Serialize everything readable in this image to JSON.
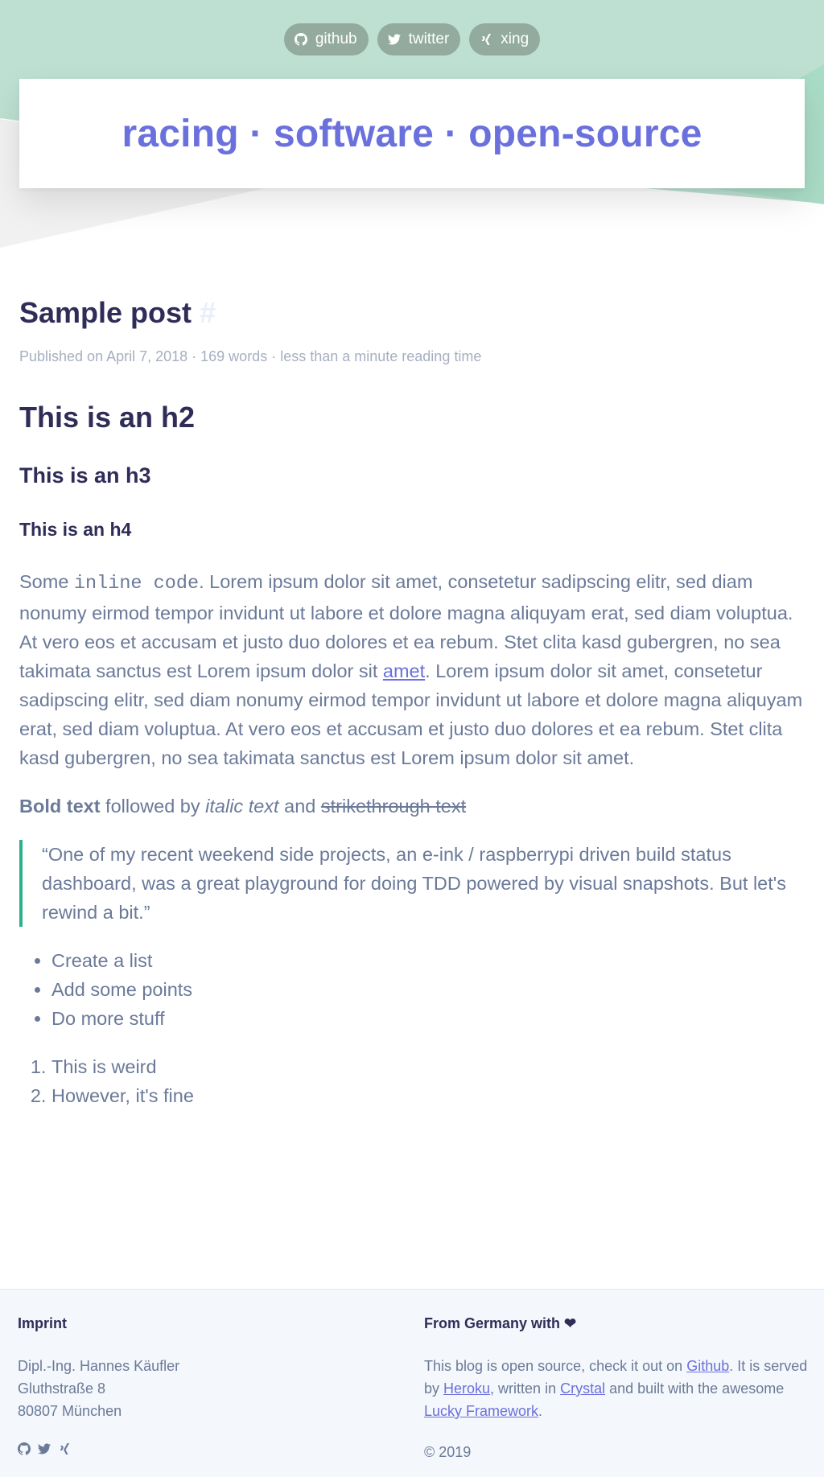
{
  "colors": {
    "accent": "#6a70dc",
    "mint": "#bde0d2",
    "heading": "#2f2d58",
    "text": "#6b7a99",
    "quote_bar": "#2eb08e",
    "pill": "#93ab9f"
  },
  "social": [
    {
      "label": "github",
      "icon": "github-icon"
    },
    {
      "label": "twitter",
      "icon": "twitter-icon"
    },
    {
      "label": "xing",
      "icon": "xing-icon"
    }
  ],
  "site_title": "racing · software · open-source",
  "post": {
    "title": "Sample post",
    "anchor": "#",
    "meta": "Published on April 7, 2018 · 169 words · less than a minute reading time",
    "h2": "This is an h2",
    "h3": "This is an h3",
    "h4": "This is an h4",
    "para_start": "Some ",
    "inline_code": "inline code",
    "para_mid": ". Lorem ipsum dolor sit amet, consetetur sadipscing elitr, sed diam nonumy eirmod tempor invidunt ut labore et dolore magna aliquyam erat, sed diam voluptua. At vero eos et accusam et justo duo dolores et ea rebum. Stet clita kasd gubergren, no sea takimata sanctus est Lorem ipsum dolor sit ",
    "para_link": "amet",
    "para_end": ". Lorem ipsum dolor sit amet, consetetur sadipscing elitr, sed diam nonumy eirmod tempor invidunt ut labore et dolore magna aliquyam erat, sed diam voluptua. At vero eos et accusam et justo duo dolores et ea rebum. Stet clita kasd gubergren, no sea takimata sanctus est Lorem ipsum dolor sit amet.",
    "bold": "Bold text",
    "followed_by": " followed by ",
    "italic": "italic text",
    "and": " and ",
    "strike": "strikethrough text",
    "quote": "“One of my recent weekend side projects, an e-ink / raspberrypi driven build status dashboard, was a great playground for doing TDD powered by visual snapshots. But let's rewind a bit.”",
    "bullets": [
      "Create a list",
      "Add some points",
      "Do more stuff"
    ],
    "numbered": [
      "This is weird",
      "However, it's fine"
    ]
  },
  "footer": {
    "imprint_title": "Imprint",
    "address": [
      "Dipl.-Ing. Hannes Käufler",
      "Gluthstraße 8",
      "80807 München"
    ],
    "right_title": "From Germany with ❤",
    "t1": "This blog is open source, check it out on ",
    "github": "Github",
    "t2": ". It is served by ",
    "heroku": "Heroku",
    "t3": ", written in ",
    "crystal": "Crystal",
    "t4": " and built with the awesome ",
    "lucky": "Lucky Framework",
    "t5": ".",
    "copyright": "© 2019"
  }
}
